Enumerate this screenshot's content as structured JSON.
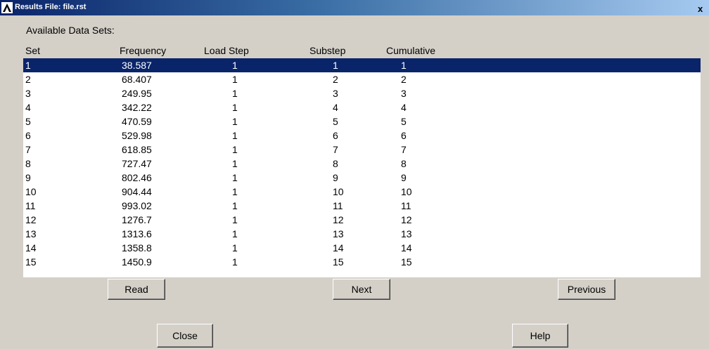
{
  "window": {
    "title": "Results File: file.rst",
    "close_glyph": "x",
    "app_icon_glyph": "Λ"
  },
  "panel": {
    "heading": "Available Data Sets:"
  },
  "table": {
    "columns": [
      "Set",
      "Frequency",
      "Load Step",
      "Substep",
      "Cumulative"
    ],
    "selected_row": 0,
    "rows": [
      [
        "1",
        "38.587",
        "1",
        "1",
        "1"
      ],
      [
        "2",
        "68.407",
        "1",
        "2",
        "2"
      ],
      [
        "3",
        "249.95",
        "1",
        "3",
        "3"
      ],
      [
        "4",
        "342.22",
        "1",
        "4",
        "4"
      ],
      [
        "5",
        "470.59",
        "1",
        "5",
        "5"
      ],
      [
        "6",
        "529.98",
        "1",
        "6",
        "6"
      ],
      [
        "7",
        "618.85",
        "1",
        "7",
        "7"
      ],
      [
        "8",
        "727.47",
        "1",
        "8",
        "8"
      ],
      [
        "9",
        "802.46",
        "1",
        "9",
        "9"
      ],
      [
        "10",
        "904.44",
        "1",
        "10",
        "10"
      ],
      [
        "11",
        "993.02",
        "1",
        "11",
        "11"
      ],
      [
        "12",
        "1276.7",
        "1",
        "12",
        "12"
      ],
      [
        "13",
        "1313.6",
        "1",
        "13",
        "13"
      ],
      [
        "14",
        "1358.8",
        "1",
        "14",
        "14"
      ],
      [
        "15",
        "1450.9",
        "1",
        "15",
        "15"
      ]
    ]
  },
  "buttons": {
    "read": "Read",
    "next": "Next",
    "previous": "Previous",
    "close": "Close",
    "help": "Help"
  },
  "colors": {
    "selection": "#0a246a",
    "dialog_bg": "#d4d0c8",
    "list_bg": "#ffffff"
  }
}
